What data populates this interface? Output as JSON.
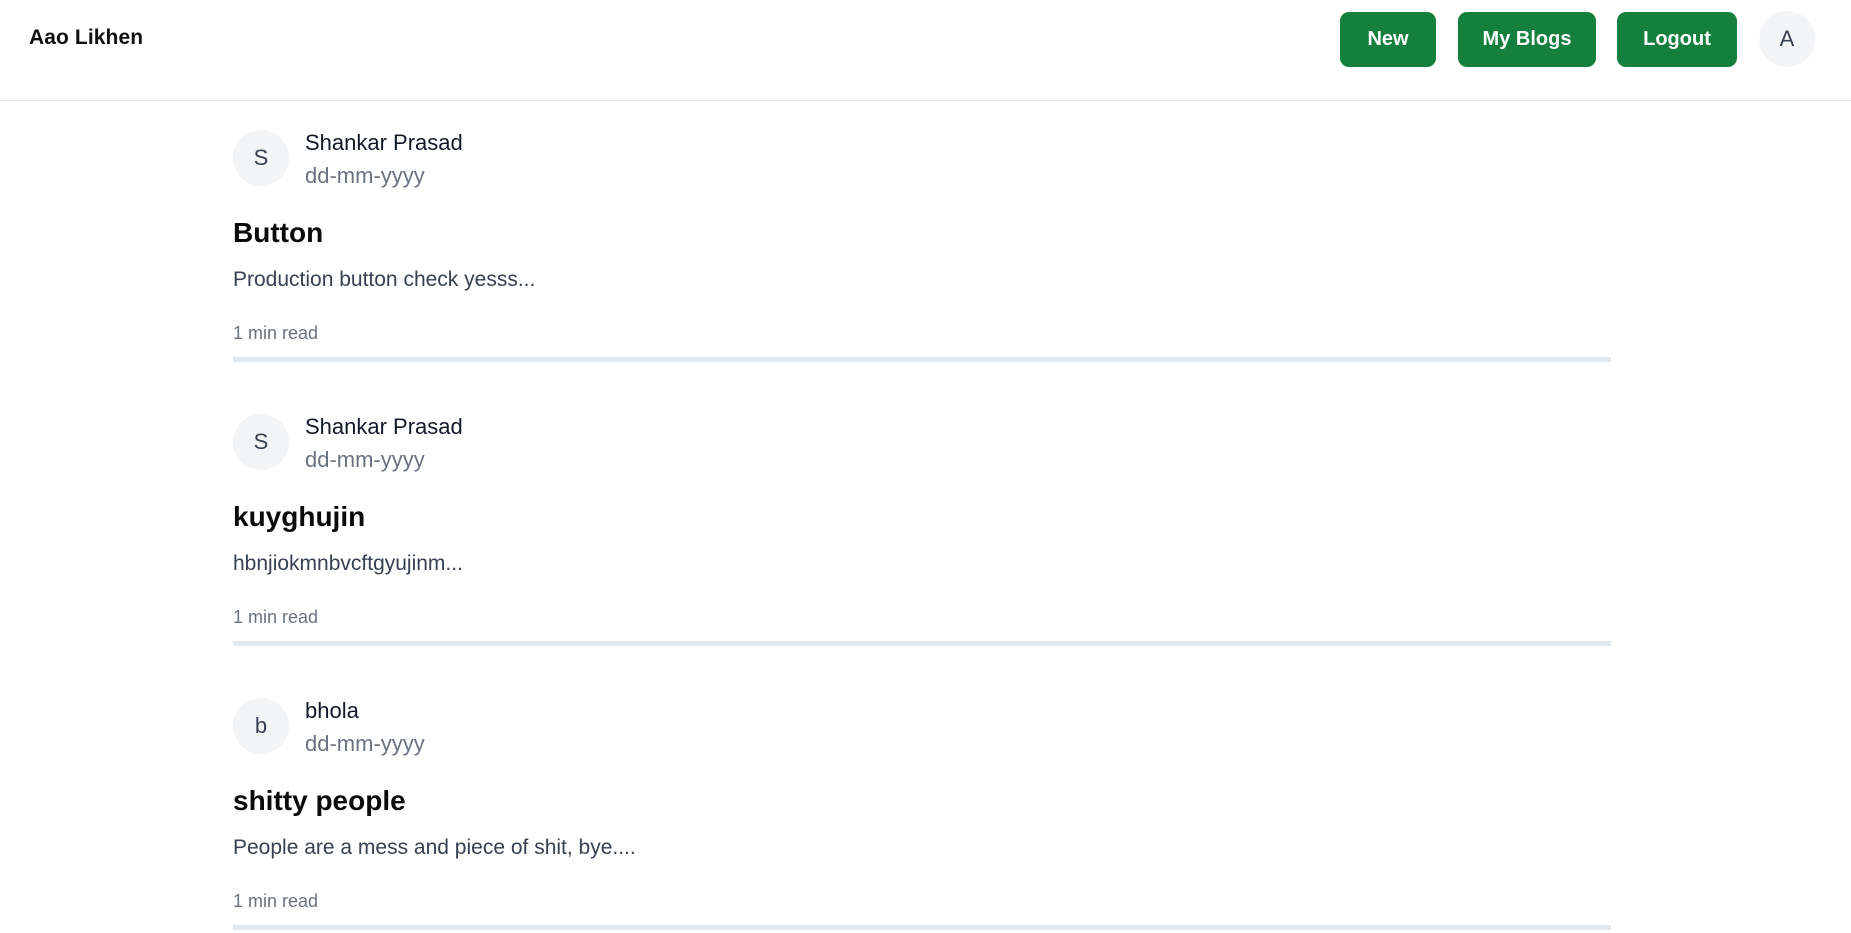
{
  "header": {
    "brand": "Aao Likhen",
    "new_label": "New",
    "my_blogs_label": "My Blogs",
    "logout_label": "Logout",
    "user_initial": "A"
  },
  "posts": [
    {
      "author_initial": "S",
      "author": "Shankar Prasad",
      "date": "dd-mm-yyyy",
      "title": "Button",
      "excerpt": "Production button check yesss...",
      "read_time": "1 min read"
    },
    {
      "author_initial": "S",
      "author": "Shankar Prasad",
      "date": "dd-mm-yyyy",
      "title": "kuyghujin",
      "excerpt": "hbnjiokmnbvcftgyujinm...",
      "read_time": "1 min read"
    },
    {
      "author_initial": "b",
      "author": "bhola",
      "date": "dd-mm-yyyy",
      "title": "shitty people",
      "excerpt": "People are a mess and piece of shit, bye....",
      "read_time": "1 min read"
    }
  ],
  "colors": {
    "accent": "#15803d",
    "divider": "#e2e8f0",
    "avatar_bg": "#f3f4f6"
  }
}
